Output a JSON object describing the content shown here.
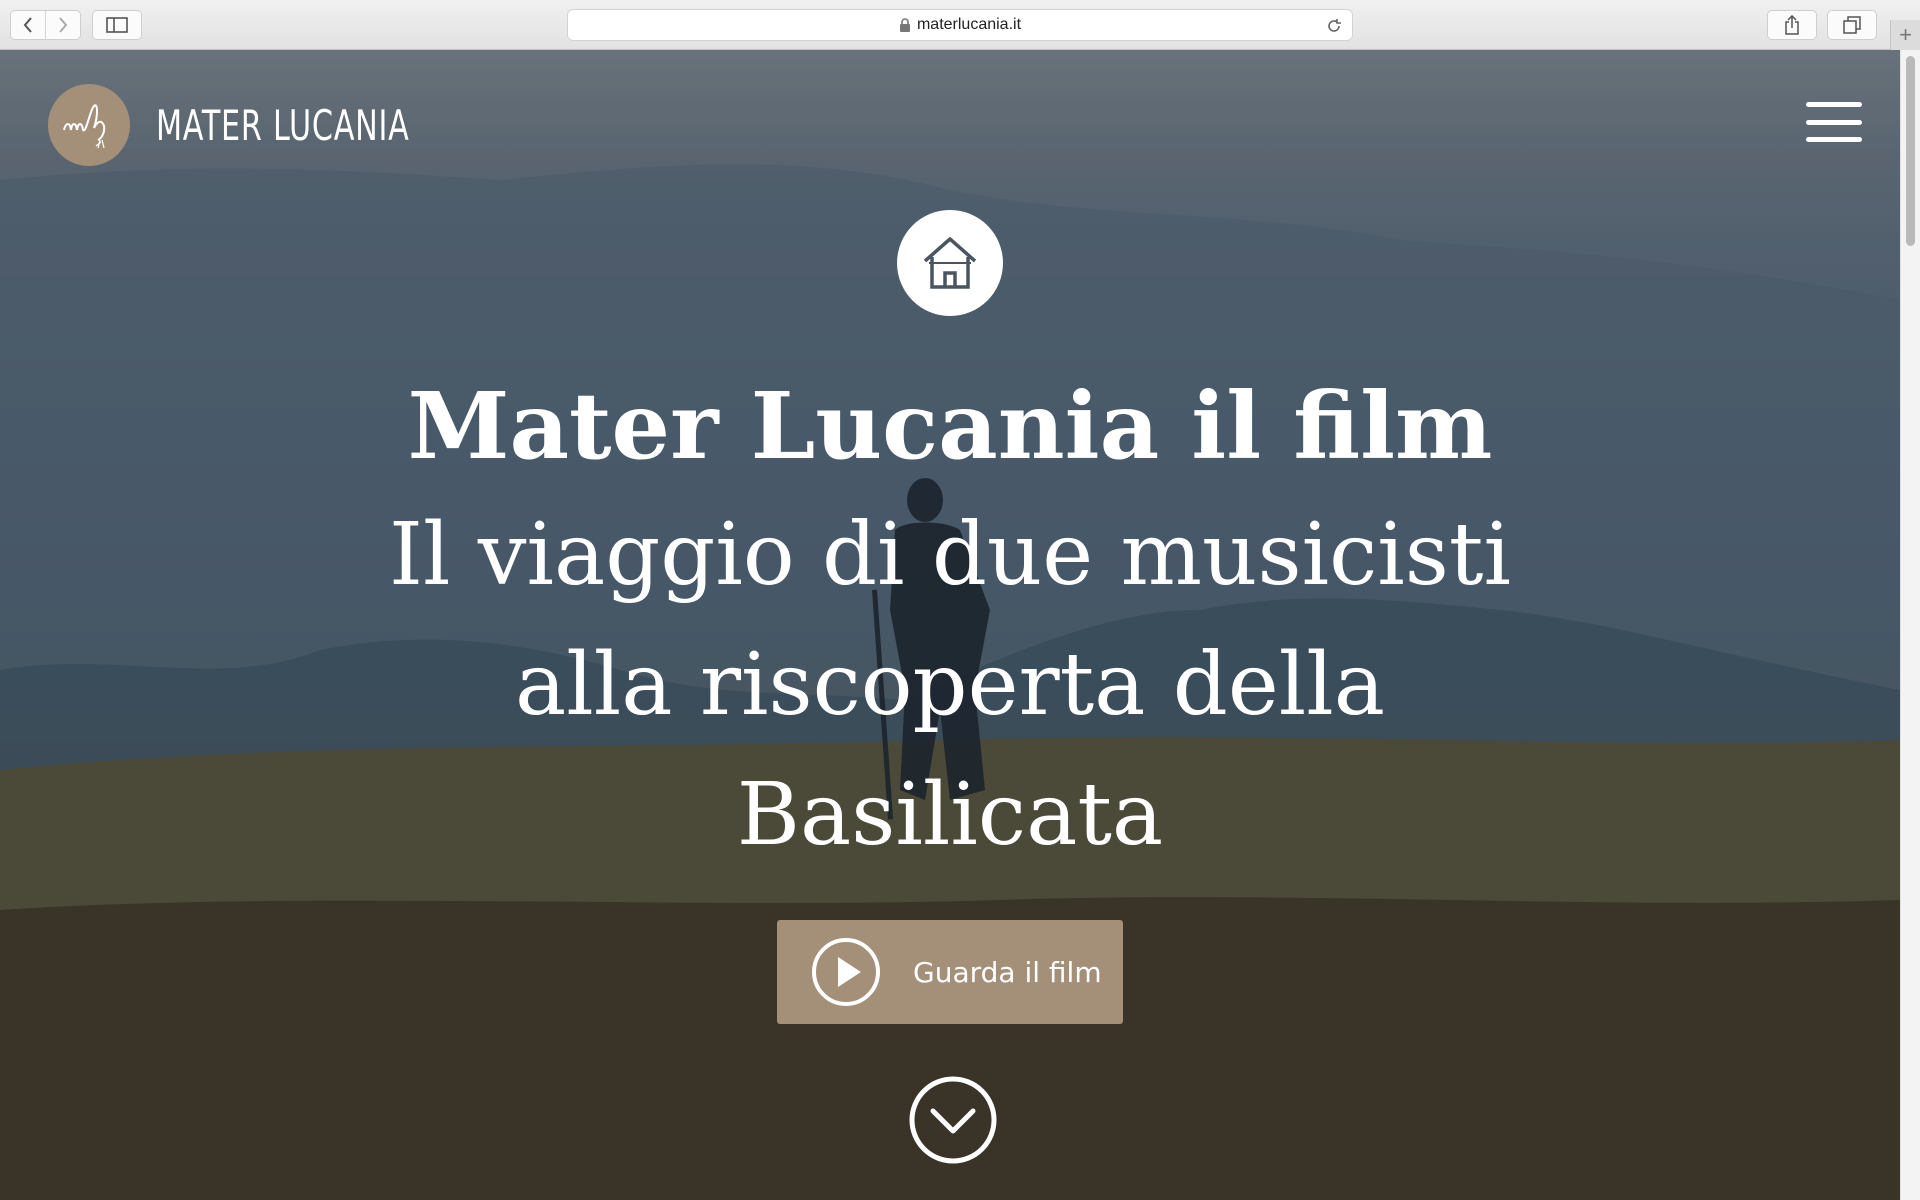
{
  "browser": {
    "url": "materlucania.it",
    "icons": {
      "back": "chevron-left-icon",
      "forward": "chevron-right-icon",
      "sidebar": "sidebar-icon",
      "lock": "lock-icon",
      "reload": "reload-icon",
      "share": "share-icon",
      "tabs": "tabs-overview-icon",
      "new_tab": "plus-icon"
    }
  },
  "site": {
    "logo_text": "MATER LUCANIA",
    "logo_monogram": "ml",
    "menu_icon": "hamburger-icon",
    "accent_color": "#a48f78"
  },
  "hero": {
    "badge_icon": "house-icon",
    "title": "Mater Lucania il film",
    "subtitle_lines": [
      "Il viaggio di due musicisti",
      "alla riscoperta della",
      "Basilicata"
    ],
    "cta_label": "Guarda il film",
    "cta_icon": "play-icon",
    "scroll_icon": "chevron-down-circle-icon"
  }
}
